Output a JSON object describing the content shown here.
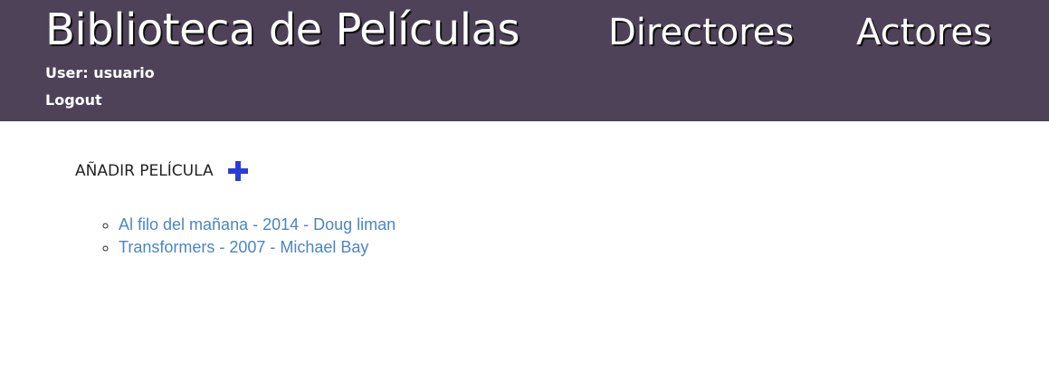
{
  "header": {
    "brand": "Biblioteca de Películas",
    "nav": [
      {
        "label": "Directores"
      },
      {
        "label": "Actores"
      }
    ],
    "user_label": "User: usuario",
    "logout_label": "Logout"
  },
  "main": {
    "add_film_label": "AÑADIR PELÍCULA",
    "add_icon": "plus-icon",
    "films": [
      {
        "label": "Al filo del mañana - 2014 - Doug liman"
      },
      {
        "label": "Transformers - 2007 - Michael Bay"
      }
    ]
  },
  "colors": {
    "header_bg": "#4e4259",
    "link": "#4a86c5",
    "add_icon": "#2b3bd8"
  }
}
